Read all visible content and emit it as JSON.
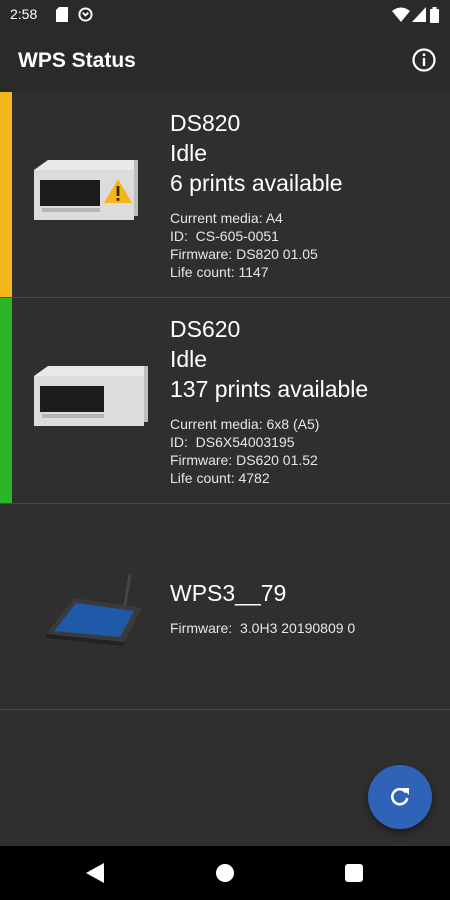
{
  "status_bar": {
    "time": "2:58",
    "left_icons": [
      "sd-card-icon",
      "sync-icon"
    ],
    "right_icons": [
      "wifi-icon",
      "signal-icon",
      "battery-icon"
    ]
  },
  "app_bar": {
    "title": "WPS Status",
    "action_icon": "info-icon"
  },
  "devices": [
    {
      "name": "DS820",
      "state": "Idle",
      "prints": "6 prints available",
      "media": "Current media: A4",
      "id": "ID:  CS-605-0051",
      "firmware": "Firmware: DS820 01.05",
      "life": "Life count: 1147",
      "status_color": "#f5b61c",
      "has_warning": true
    },
    {
      "name": "DS620",
      "state": "Idle",
      "prints": "137 prints available",
      "media": "Current media: 6x8 (A5)",
      "id": "ID:  DS6X54003195",
      "firmware": "Firmware: DS620 01.52",
      "life": "Life count: 4782",
      "status_color": "#2bb52b",
      "has_warning": false
    },
    {
      "name": "WPS3__79",
      "firmware": "Firmware:  3.0H3 20190809 0"
    }
  ],
  "fab": {
    "icon": "refresh-icon",
    "color": "#2e63b8"
  },
  "nav_bar": {
    "icons": [
      "back-icon",
      "home-icon",
      "recents-icon"
    ]
  }
}
